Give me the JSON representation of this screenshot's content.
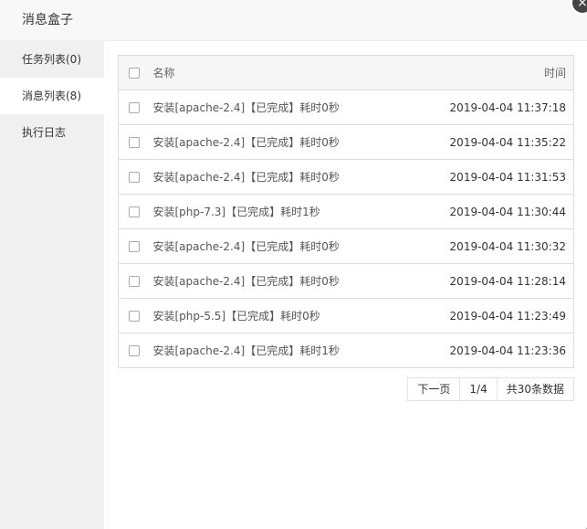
{
  "modal": {
    "title": "消息盒子",
    "close_glyph": "×"
  },
  "sidebar": {
    "items": [
      {
        "label": "任务列表(0)",
        "active": false
      },
      {
        "label": "消息列表(8)",
        "active": true
      },
      {
        "label": "执行日志",
        "active": false
      }
    ]
  },
  "table": {
    "headers": {
      "name": "名称",
      "time": "时间"
    },
    "rows": [
      {
        "name": "安装[apache-2.4]【已完成】耗时0秒",
        "time": "2019-04-04 11:37:18"
      },
      {
        "name": "安装[apache-2.4]【已完成】耗时0秒",
        "time": "2019-04-04 11:35:22"
      },
      {
        "name": "安装[apache-2.4]【已完成】耗时0秒",
        "time": "2019-04-04 11:31:53"
      },
      {
        "name": "安装[php-7.3]【已完成】耗时1秒",
        "time": "2019-04-04 11:30:44"
      },
      {
        "name": "安装[apache-2.4]【已完成】耗时0秒",
        "time": "2019-04-04 11:30:32"
      },
      {
        "name": "安装[apache-2.4]【已完成】耗时0秒",
        "time": "2019-04-04 11:28:14"
      },
      {
        "name": "安装[php-5.5]【已完成】耗时0秒",
        "time": "2019-04-04 11:23:49"
      },
      {
        "name": "安装[apache-2.4]【已完成】耗时1秒",
        "time": "2019-04-04 11:23:36"
      }
    ]
  },
  "pager": {
    "next_label": "下一页",
    "page_indicator": "1/4",
    "total_label": "共30条数据"
  }
}
